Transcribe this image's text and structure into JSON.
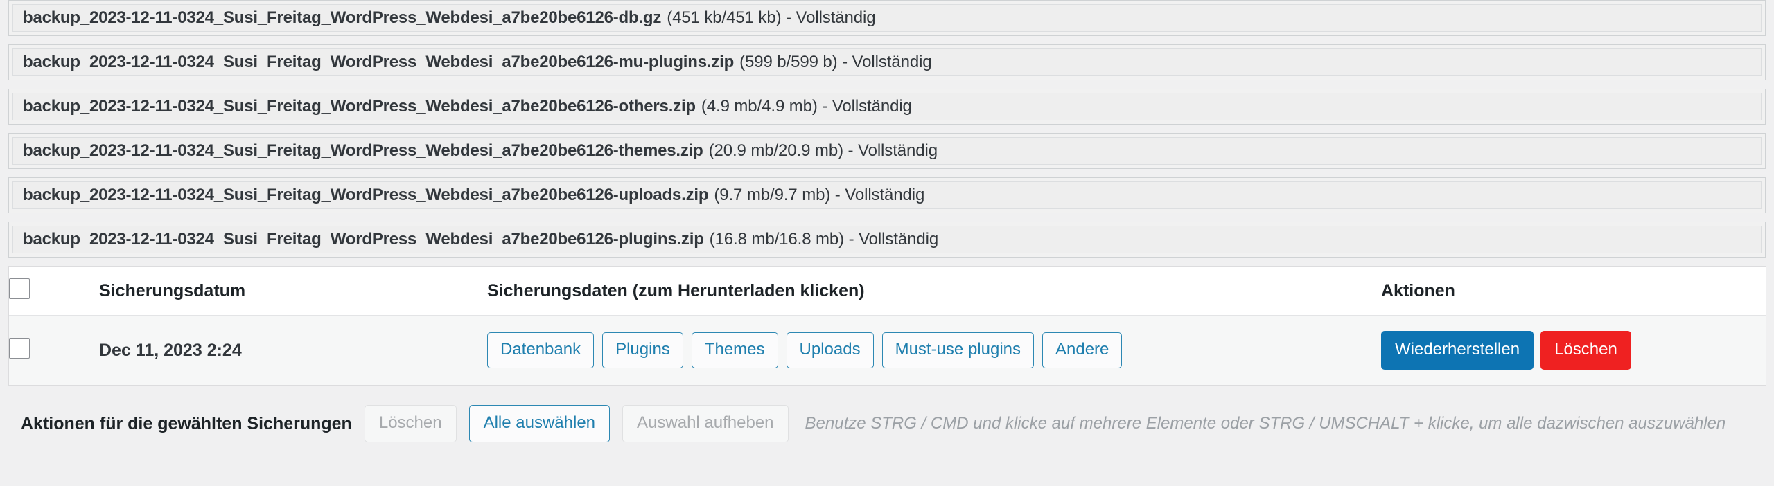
{
  "backup_log": {
    "rows": [
      {
        "file": "backup_2023-12-11-0324_Susi_Freitag_WordPress_Webdesi_a7be20be6126-db.gz",
        "meta": "(451 kb/451 kb) - Vollständig"
      },
      {
        "file": "backup_2023-12-11-0324_Susi_Freitag_WordPress_Webdesi_a7be20be6126-mu-plugins.zip",
        "meta": "(599 b/599 b) - Vollständig"
      },
      {
        "file": "backup_2023-12-11-0324_Susi_Freitag_WordPress_Webdesi_a7be20be6126-others.zip",
        "meta": "(4.9 mb/4.9 mb) - Vollständig"
      },
      {
        "file": "backup_2023-12-11-0324_Susi_Freitag_WordPress_Webdesi_a7be20be6126-themes.zip",
        "meta": "(20.9 mb/20.9 mb) - Vollständig"
      },
      {
        "file": "backup_2023-12-11-0324_Susi_Freitag_WordPress_Webdesi_a7be20be6126-uploads.zip",
        "meta": "(9.7 mb/9.7 mb) - Vollständig"
      },
      {
        "file": "backup_2023-12-11-0324_Susi_Freitag_WordPress_Webdesi_a7be20be6126-plugins.zip",
        "meta": "(16.8 mb/16.8 mb) - Vollständig"
      }
    ]
  },
  "table": {
    "headers": {
      "select_all": "",
      "date": "Sicherungsdatum",
      "data": "Sicherungsdaten (zum Herunterladen klicken)",
      "actions": "Aktionen"
    },
    "rows": [
      {
        "date": "Dec 11, 2023 2:24",
        "entities": [
          "Datenbank",
          "Plugins",
          "Themes",
          "Uploads",
          "Must-use plugins",
          "Andere"
        ],
        "actions": [
          {
            "label": "Wiederherstellen",
            "style": "restore"
          },
          {
            "label": "Löschen",
            "style": "delete"
          }
        ]
      }
    ]
  },
  "bulk_bar": {
    "label": "Aktionen für die gewählten Sicherungen",
    "buttons": [
      {
        "label": "Löschen",
        "state": "disabled"
      },
      {
        "label": "Alle auswählen",
        "state": "active"
      },
      {
        "label": "Auswahl aufheben",
        "state": "disabled"
      }
    ],
    "hint": "Benutze STRG / CMD und klicke auf mehrere Elemente oder STRG / UMSCHALT + klicke, um alle dazwischen auszuwählen"
  },
  "colors": {
    "link_blue": "#1f7fae",
    "restore_blue": "#0d74b3",
    "delete_red": "#ef2121",
    "page_bg": "#f0f0f1",
    "row_bg": "#eeeeee"
  }
}
